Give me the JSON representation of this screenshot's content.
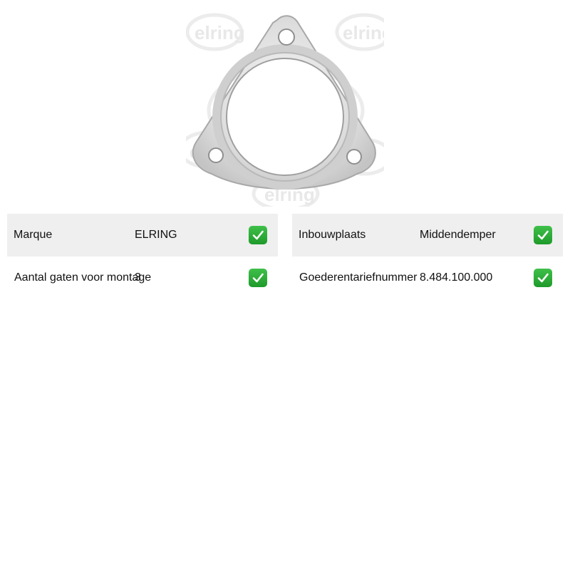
{
  "product_image": {
    "alt": "Exhaust gasket",
    "watermark": "elring"
  },
  "specs_left": [
    {
      "label": "Marque",
      "value": "ELRING",
      "icon": "checkmark-icon"
    },
    {
      "label": "Aantal gaten voor montage",
      "value": "3",
      "icon": "checkmark-icon"
    }
  ],
  "specs_right": [
    {
      "label": "Inbouwplaats",
      "value": "Middendemper",
      "icon": "checkmark-icon"
    },
    {
      "label": "Goederentariefnummer",
      "value": "8.484.100.000",
      "icon": "checkmark-icon"
    }
  ],
  "colors": {
    "row_shade": "#efefef",
    "check_green": "#2aac36"
  }
}
